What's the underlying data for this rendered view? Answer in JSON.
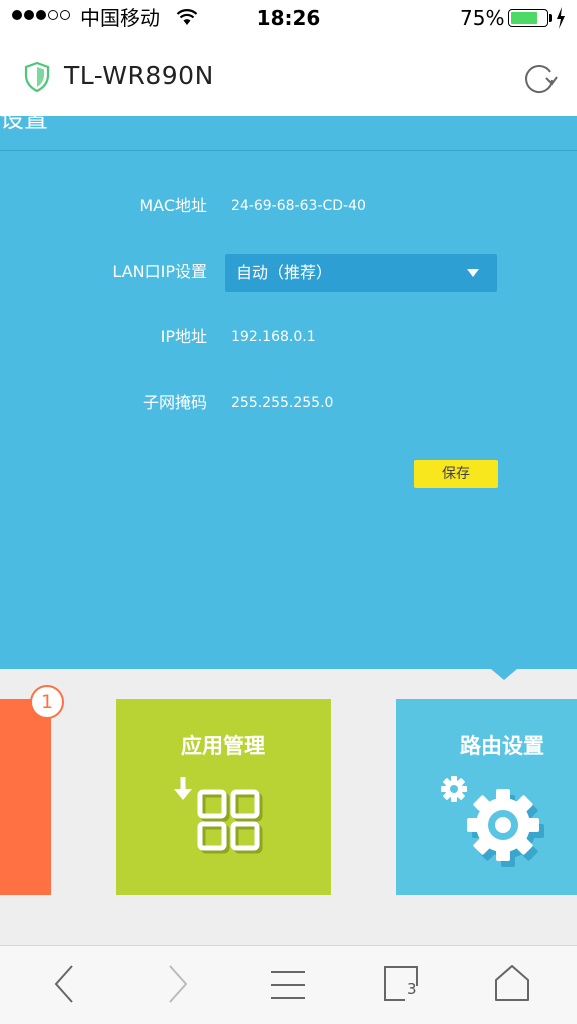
{
  "status_bar": {
    "carrier": "中国移动",
    "time": "18:26",
    "battery_percent": "75%",
    "battery_level": 0.75,
    "signal_bars_filled": 3,
    "signal_bars_total": 5
  },
  "header": {
    "title": "TL-WR890N"
  },
  "panel": {
    "title": "设置",
    "fields": [
      {
        "label": "MAC地址",
        "value": "24-69-68-63-CD-40"
      },
      {
        "label": "LAN口IP设置",
        "value": "自动（推荐）"
      },
      {
        "label": "IP地址",
        "value": "192.168.0.1"
      },
      {
        "label": "子网掩码",
        "value": "255.255.255.0"
      }
    ],
    "save_label": "保存"
  },
  "tiles": [
    {
      "label": "",
      "badge": "1",
      "color": "#ff7043"
    },
    {
      "label": "应用管理",
      "color": "#b9d334",
      "icon": "app-grid-download-icon"
    },
    {
      "label": "路由设置",
      "color": "#5ac5e3",
      "icon": "gears-icon"
    }
  ],
  "toolbar": {
    "tab_count": "3",
    "icons": [
      "back-icon",
      "forward-icon",
      "menu-icon",
      "tabs-icon",
      "home-icon"
    ]
  },
  "colors": {
    "panel_blue": "#4bbbe1",
    "select_blue": "#2d9fd3",
    "save_yellow": "#f9e71e",
    "shield_green": "#4cc77a",
    "battery_green": "#4cd964"
  }
}
